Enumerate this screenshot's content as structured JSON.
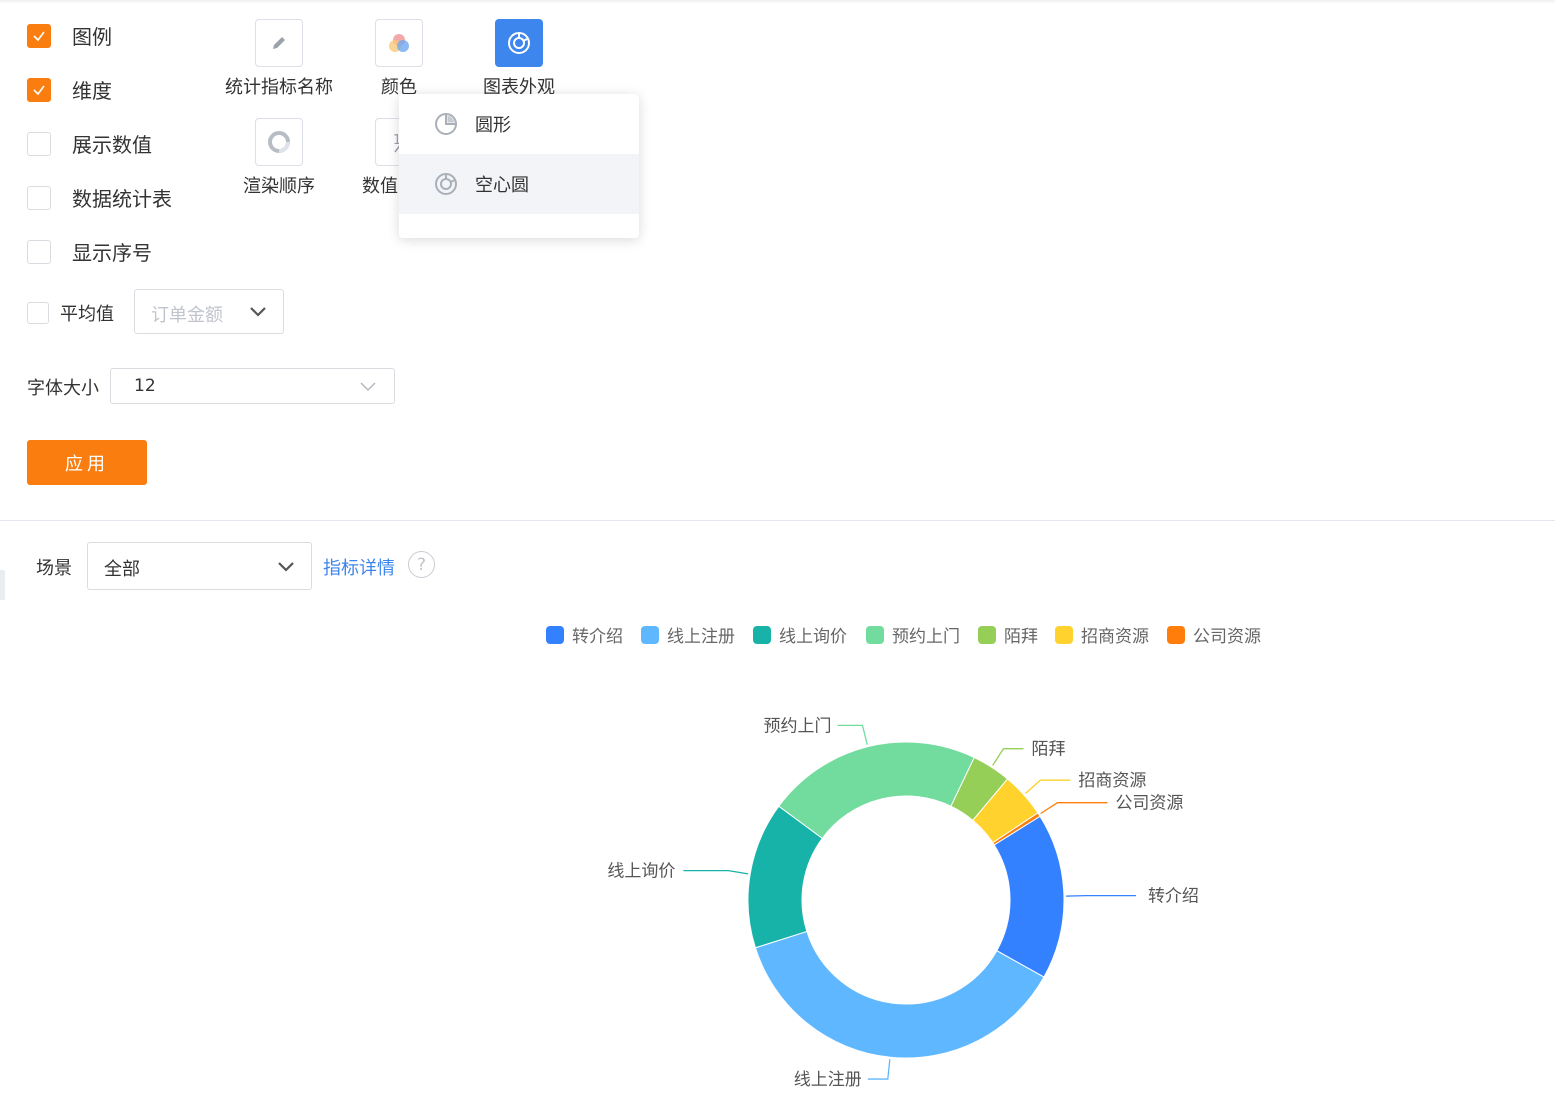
{
  "options": [
    {
      "label": "图例",
      "checked": true
    },
    {
      "label": "维度",
      "checked": true
    },
    {
      "label": "展示数值",
      "checked": false
    },
    {
      "label": "数据统计表",
      "checked": false
    },
    {
      "label": "显示序号",
      "checked": false
    }
  ],
  "tools": {
    "metric_name": {
      "label": "统计指标名称",
      "icon": "pencil-icon"
    },
    "color": {
      "label": "颜色",
      "icon": "palette-icon"
    },
    "appearance": {
      "label": "图表外观",
      "icon": "donut-chart-icon",
      "active": true
    },
    "render_order": {
      "label": "渲染顺序",
      "icon": "ring-icon"
    },
    "value": {
      "label": "数值",
      "icon": "value-format-icon"
    }
  },
  "appearance_menu": {
    "items": [
      {
        "label": "圆形",
        "icon": "pie-chart-icon"
      },
      {
        "label": "空心圆",
        "icon": "donut-chart-icon",
        "highlighted": true
      }
    ]
  },
  "average": {
    "label": "平均值",
    "checked": false,
    "placeholder": "订单金额"
  },
  "font_size": {
    "label": "字体大小",
    "value": "12"
  },
  "apply_label": "应用",
  "filter": {
    "label": "场景",
    "value": "全部",
    "link": "指标详情",
    "help": "?"
  },
  "colors": {
    "accent": "#fa7d10",
    "primary": "#3d86ee"
  },
  "chart_data": {
    "type": "pie",
    "variant": "donut",
    "legend_position": "top",
    "series": [
      {
        "name": "转介绍",
        "value": 17,
        "color": "#3381ff"
      },
      {
        "name": "线上注册",
        "value": 37,
        "color": "#5fb8ff"
      },
      {
        "name": "线上询价",
        "value": 15,
        "color": "#17b3a8"
      },
      {
        "name": "预约上门",
        "value": 22,
        "color": "#72db9e"
      },
      {
        "name": "陌拜",
        "value": 4,
        "color": "#95cf57"
      },
      {
        "name": "招商资源",
        "value": 4.6,
        "color": "#ffd22e"
      },
      {
        "name": "公司资源",
        "value": 0.4,
        "color": "#ff7d0a"
      }
    ]
  }
}
